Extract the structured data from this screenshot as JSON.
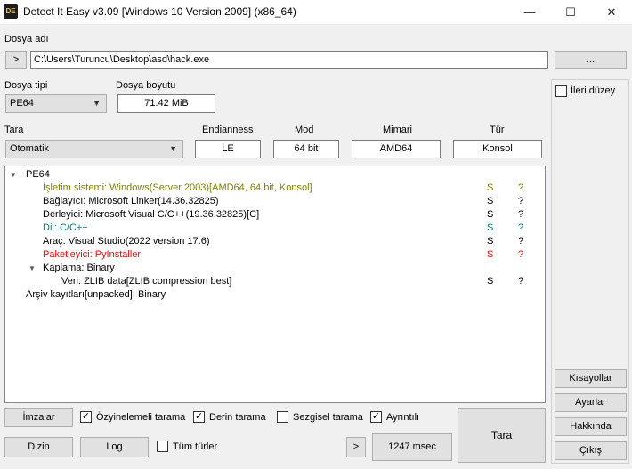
{
  "window": {
    "title": "Detect It Easy v3.09 [Windows 10 Version 2009] (x86_64)",
    "minimize": "—",
    "maximize": "☐",
    "close": "✕",
    "icon_text": "DE"
  },
  "file": {
    "label": "Dosya adı",
    "open_button": ">",
    "path": "C:\\Users\\Turuncu\\Desktop\\asd\\hack.exe",
    "browse_button": "..."
  },
  "file_type": {
    "label": "Dosya tipi",
    "value": "PE64"
  },
  "file_size": {
    "label": "Dosya boyutu",
    "value": "71.42 MiB"
  },
  "scan": {
    "label": "Tara",
    "value": "Otomatik"
  },
  "info": {
    "endianness": {
      "label": "Endianness",
      "value": "LE"
    },
    "mode": {
      "label": "Mod",
      "value": "64 bit"
    },
    "arch": {
      "label": "Mimari",
      "value": "AMD64"
    },
    "type": {
      "label": "Tür",
      "value": "Konsol"
    }
  },
  "tree": {
    "root": "PE64",
    "rows": [
      {
        "text": "İşletim sistemi: Windows(Server 2003)[AMD64, 64 bit, Konsol]",
        "s": "S",
        "q": "?",
        "color": "#808000"
      },
      {
        "text": "Bağlayıcı: Microsoft Linker(14.36.32825)",
        "s": "S",
        "q": "?",
        "color": "#000000"
      },
      {
        "text": "Derleyici: Microsoft Visual C/C++(19.36.32825)[C]",
        "s": "S",
        "q": "?",
        "color": "#000000"
      },
      {
        "text": "Dil: C/C++",
        "s": "S",
        "q": "?",
        "color": "#008080"
      },
      {
        "text": "Araç: Visual Studio(2022 version 17.6)",
        "s": "S",
        "q": "?",
        "color": "#000000"
      },
      {
        "text": "Paketleyici: PyInstaller",
        "s": "S",
        "q": "?",
        "color": "#ff0000"
      }
    ],
    "overlay": "Kaplama: Binary",
    "overlay_child": {
      "text": "Veri: ZLIB data[ZLIB compression best]",
      "s": "S",
      "q": "?"
    },
    "archive": "Arşiv kayıtları[unpacked]: Binary"
  },
  "right": {
    "advanced_label": "İleri düzey",
    "shortcuts": "Kısayollar",
    "settings": "Ayarlar",
    "about": "Hakkında",
    "exit": "Çıkış"
  },
  "bottom": {
    "signatures": "İmzalar",
    "recursive": "Özyinelemeli tarama",
    "deep": "Derin tarama",
    "heuristic": "Sezgisel tarama",
    "verbose": "Ayrıntılı",
    "directory": "Dizin",
    "log": "Log",
    "all_types": "Tüm türler",
    "arrow": ">",
    "time": "1247 msec",
    "scan_button": "Tara"
  },
  "checks": {
    "recursive": true,
    "deep": true,
    "heuristic": false,
    "verbose": true,
    "all_types": false,
    "advanced": false
  }
}
